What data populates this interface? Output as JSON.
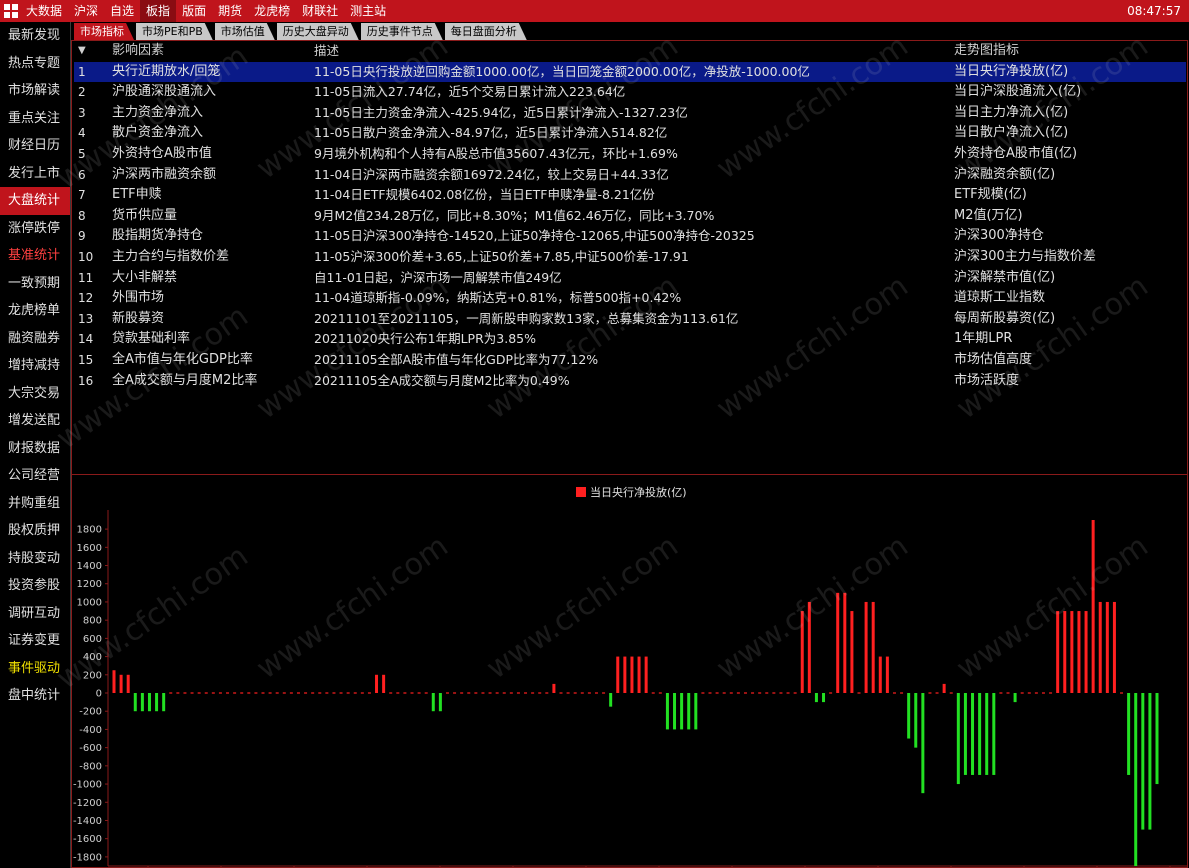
{
  "topbar": {
    "menu": [
      "大数据",
      "沪深",
      "自选",
      "板指",
      "版面",
      "期货",
      "龙虎榜",
      "财联社",
      "测主站"
    ],
    "active_index": 3,
    "clock": "08:47:57"
  },
  "sidebar": {
    "items": [
      "最新发现",
      "热点专题",
      "市场解读",
      "重点关注",
      "财经日历",
      "发行上市",
      "大盘统计",
      "涨停跌停",
      "基准统计",
      "一致预期",
      "龙虎榜单",
      "融资融券",
      "增持减持",
      "大宗交易",
      "增发送配",
      "财报数据",
      "公司经营",
      "并购重组",
      "股权质押",
      "持股变动",
      "投资参股",
      "调研互动",
      "证券变更",
      "事件驱动",
      "盘中统计"
    ],
    "active_index": 6,
    "red_index": 8,
    "yellow_index": 23
  },
  "tabs": [
    "市场指标",
    "市场PE和PB",
    "市场估值",
    "历史大盘异动",
    "历史事件节点",
    "每日盘面分析"
  ],
  "table": {
    "headers": {
      "idx": "▼",
      "name": "影响因素",
      "desc": "描述",
      "indicator": "走势图指标"
    },
    "selected_index": 0,
    "rows": [
      {
        "idx": "1",
        "name": "央行近期放水/回笼",
        "desc": "11-05日央行投放逆回购金额1000.00亿，当日回笼金额2000.00亿，净投放-1000.00亿",
        "indicator": "当日央行净投放(亿)"
      },
      {
        "idx": "2",
        "name": "沪股通深股通流入",
        "desc": "11-05日流入27.74亿，近5个交易日累计流入223.64亿",
        "indicator": "当日沪深股通流入(亿)"
      },
      {
        "idx": "3",
        "name": "主力资金净流入",
        "desc": "11-05日主力资金净流入-425.94亿，近5日累计净流入-1327.23亿",
        "indicator": "当日主力净流入(亿)"
      },
      {
        "idx": "4",
        "name": "散户资金净流入",
        "desc": "11-05日散户资金净流入-84.97亿，近5日累计净流入514.82亿",
        "indicator": "当日散户净流入(亿)"
      },
      {
        "idx": "5",
        "name": "外资持仓A股市值",
        "desc": "9月境外机构和个人持有A股总市值35607.43亿元，环比+1.69%",
        "indicator": "外资持仓A股市值(亿)"
      },
      {
        "idx": "6",
        "name": "沪深两市融资余额",
        "desc": "11-04日沪深两市融资余额16972.24亿，较上交易日+44.33亿",
        "indicator": "沪深融资余额(亿)"
      },
      {
        "idx": "7",
        "name": "ETF申赎",
        "desc": "11-04日ETF规模6402.08亿份，当日ETF申赎净量-8.21亿份",
        "indicator": "ETF规模(亿)"
      },
      {
        "idx": "8",
        "name": "货币供应量",
        "desc": "9月M2值234.28万亿，同比+8.30%；M1值62.46万亿，同比+3.70%",
        "indicator": "M2值(万亿)"
      },
      {
        "idx": "9",
        "name": "股指期货净持仓",
        "desc": "11-05日沪深300净持仓-14520,上证50净持仓-12065,中证500净持仓-20325",
        "indicator": "沪深300净持仓"
      },
      {
        "idx": "10",
        "name": "主力合约与指数价差",
        "desc": "11-05沪深300价差+3.65,上证50价差+7.85,中证500价差-17.91",
        "indicator": "沪深300主力与指数价差"
      },
      {
        "idx": "11",
        "name": "大小非解禁",
        "desc": "自11-01日起，沪深市场一周解禁市值249亿",
        "indicator": "沪深解禁市值(亿)"
      },
      {
        "idx": "12",
        "name": "外围市场",
        "desc": "11-04道琼斯指-0.09%，纳斯达克+0.81%，标普500指+0.42%",
        "indicator": "道琼斯工业指数"
      },
      {
        "idx": "13",
        "name": "新股募资",
        "desc": "20211101至20211105，一周新股申购家数13家，总募集资金为113.61亿",
        "indicator": "每周新股募资(亿)"
      },
      {
        "idx": "14",
        "name": "贷款基础利率",
        "desc": "20211020央行公布1年期LPR为3.85%",
        "indicator": "1年期LPR"
      },
      {
        "idx": "15",
        "name": "全A市值与年化GDP比率",
        "desc": "20211105全部A股市值与年化GDP比率为77.12%",
        "indicator": "市场估值高度"
      },
      {
        "idx": "16",
        "name": "全A成交额与月度M2比率",
        "desc": "20211105全A成交额与月度M2比率为0.49%",
        "indicator": "市场活跃度"
      }
    ]
  },
  "chart_data": {
    "type": "bar",
    "legend": "当日央行净投放(亿)",
    "ylim": [
      -1900,
      1900
    ],
    "yticks": [
      1800,
      1600,
      1400,
      1200,
      1000,
      800,
      600,
      400,
      200,
      0,
      -200,
      -400,
      -600,
      -800,
      -1000,
      -1200,
      -1400,
      -1600,
      -1800
    ],
    "colors": {
      "positive": "#ff2020",
      "negative": "#22e022",
      "zero": "#ff2020"
    },
    "values": [
      250,
      200,
      200,
      -200,
      -200,
      -200,
      -200,
      -200,
      0,
      0,
      0,
      0,
      0,
      0,
      0,
      0,
      0,
      0,
      0,
      0,
      0,
      0,
      0,
      0,
      0,
      0,
      0,
      0,
      0,
      0,
      0,
      0,
      0,
      0,
      0,
      0,
      0,
      200,
      200,
      0,
      0,
      0,
      0,
      0,
      0,
      -200,
      -200,
      0,
      0,
      0,
      0,
      0,
      0,
      0,
      0,
      0,
      0,
      0,
      0,
      0,
      0,
      0,
      100,
      0,
      0,
      0,
      0,
      0,
      0,
      0,
      -150,
      400,
      400,
      400,
      400,
      400,
      0,
      0,
      -400,
      -400,
      -400,
      -400,
      -400,
      0,
      0,
      0,
      0,
      0,
      0,
      0,
      0,
      0,
      0,
      0,
      0,
      0,
      0,
      900,
      1000,
      -100,
      -100,
      0,
      1100,
      1100,
      900,
      0,
      1000,
      1000,
      400,
      400,
      0,
      0,
      -500,
      -600,
      -1100,
      0,
      0,
      100,
      0,
      -1000,
      -900,
      -900,
      -900,
      -900,
      -900,
      0,
      0,
      -100,
      0,
      0,
      0,
      0,
      0,
      900,
      900,
      900,
      900,
      900,
      1900,
      1000,
      1000,
      1000,
      0,
      -900,
      -1900,
      -1500,
      -1500,
      -1000
    ]
  },
  "watermark": "www.cfchi.com"
}
